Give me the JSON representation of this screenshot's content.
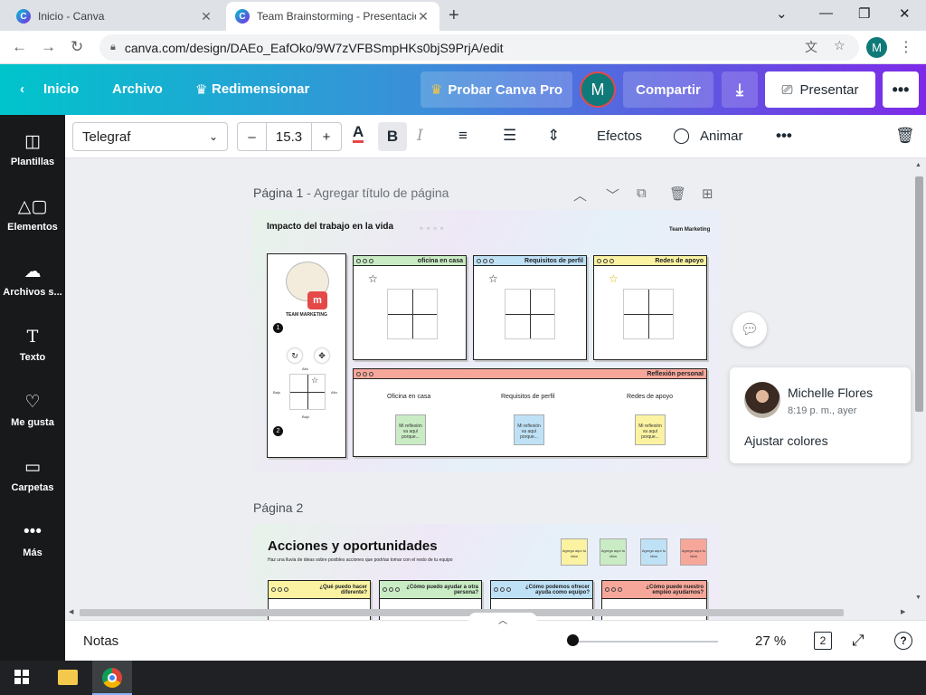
{
  "browser": {
    "tabs": [
      {
        "title": "Inicio - Canva",
        "favicon": "C"
      },
      {
        "title": "Team Brainstorming - Presentación",
        "favicon": "C"
      }
    ],
    "url": "canva.com/design/DAEo_EafOko/9W7zVFBSmpHKs0bjS9PrjA/edit",
    "profile_initial": "M"
  },
  "header": {
    "back_label": "Inicio",
    "file_label": "Archivo",
    "resize_label": "Redimensionar",
    "pro_label": "Probar Canva Pro",
    "avatar_initial": "M",
    "share_label": "Compartir",
    "present_label": "Presentar"
  },
  "sidebar": {
    "items": [
      {
        "label": "Plantillas",
        "icon": "templates-icon"
      },
      {
        "label": "Elementos",
        "icon": "elements-icon"
      },
      {
        "label": "Archivos s...",
        "icon": "upload-icon"
      },
      {
        "label": "Texto",
        "icon": "text-icon"
      },
      {
        "label": "Me gusta",
        "icon": "heart-icon"
      },
      {
        "label": "Carpetas",
        "icon": "folder-icon"
      },
      {
        "label": "Más",
        "icon": "more-icon"
      }
    ]
  },
  "toolbar": {
    "font": "Telegraf",
    "font_size": "15.3",
    "minus": "–",
    "plus": "+",
    "effects_label": "Efectos",
    "animate_label": "Animar"
  },
  "pages": [
    {
      "label": "Página 1",
      "subtitle": "Agregar título de página"
    },
    {
      "label": "Página 2"
    }
  ],
  "slide1": {
    "title": "Impacto del trabajo en la vida",
    "tag": "Team Marketing",
    "cards": [
      {
        "title": "oficina en casa",
        "color": "#c9ecc4"
      },
      {
        "title": "Requisitos de perfil",
        "color": "#bfe1f6"
      },
      {
        "title": "Redes de apoyo",
        "color": "#fbf3a2"
      }
    ],
    "reflection": {
      "title": "Reflexión personal",
      "color": "#f7a79a",
      "columns": [
        "Oficina en casa",
        "Requisitos de perfil",
        "Redes de apoyo"
      ],
      "sticky_text": "Mi reflexión va aquí porque...",
      "sticky_colors": [
        "#c9ecc4",
        "#bfe1f6",
        "#fbf3a2"
      ]
    },
    "left_panel": {
      "heading": "TEAM MARKETING",
      "step1": "1",
      "step2": "2",
      "axis_top": "Alto",
      "axis_bottom": "Bajo",
      "axis_left": "Bajo",
      "axis_right": "Alto"
    }
  },
  "slide2": {
    "title": "Acciones y oportunidades",
    "subtitle": "Haz una lluvia de ideas sobre posibles acciones que podrías tomar con el resto de tu equipo",
    "cards": [
      {
        "title": "¿Qué puedo hacer diferente?",
        "color": "#fbf3a2"
      },
      {
        "title": "¿Cómo puedo ayudar a otra persona?",
        "color": "#c9ecc4"
      },
      {
        "title": "¿Cómo podemos ofrecer ayuda como equipo?",
        "color": "#bfe1f6"
      },
      {
        "title": "¿Cómo puede nuestro empleo ayudarnos?",
        "color": "#f7a79a"
      }
    ],
    "sticky_text": "Agrega aquí tu idea",
    "sticky_colors": [
      "#fbf3a2",
      "#c9ecc4",
      "#bfe1f6",
      "#f7a79a"
    ]
  },
  "comment": {
    "author": "Michelle Flores",
    "time": "8:19 p. m., ayer",
    "text": "Ajustar colores"
  },
  "bottombar": {
    "notes_label": "Notas",
    "zoom": "27 %",
    "page_count": "2",
    "zoom_fraction": 0
  }
}
